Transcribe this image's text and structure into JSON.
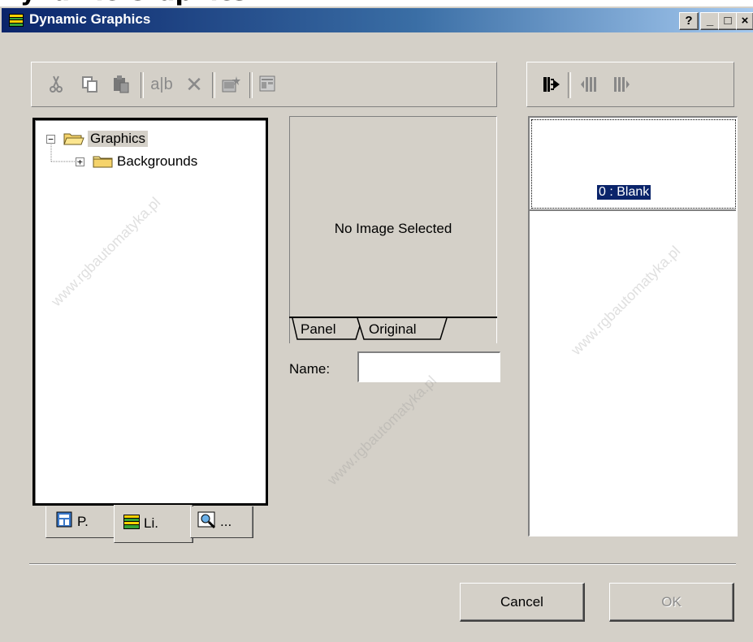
{
  "page_header": "Dynamic Graphics",
  "window": {
    "title": "Dynamic Graphics"
  },
  "caption_buttons": {
    "help": "?",
    "minimize": "_",
    "maximize": "□",
    "close": "×"
  },
  "toolbar_left": {
    "items": [
      {
        "icon": "cut-icon",
        "glyph": "✂"
      },
      {
        "icon": "copy-icon",
        "glyph": "⎘"
      },
      {
        "icon": "paste-icon",
        "glyph": "▦"
      },
      {
        "icon": "rename-icon",
        "glyph": "ab"
      },
      {
        "icon": "delete-icon",
        "glyph": "✕"
      },
      {
        "icon": "new-item-icon",
        "glyph": "✱"
      },
      {
        "icon": "properties-icon",
        "glyph": "☷"
      }
    ]
  },
  "toolbar_right": {
    "items": [
      {
        "icon": "insert-frame-icon"
      },
      {
        "icon": "frame-left-icon"
      },
      {
        "icon": "frame-right-icon"
      }
    ]
  },
  "tree": {
    "root": {
      "label": "Graphics",
      "expander": "−"
    },
    "child": {
      "label": "Backgrounds",
      "expander": "+"
    }
  },
  "left_tabs": [
    {
      "label": "P."
    },
    {
      "label": "Li."
    },
    {
      "label": "..."
    }
  ],
  "preview": {
    "message": "No Image Selected",
    "tabs": [
      {
        "label": "Panel"
      },
      {
        "label": "Original"
      }
    ]
  },
  "name_field": {
    "label": "Name:",
    "value": ""
  },
  "frames": [
    {
      "label": "0 : Blank"
    }
  ],
  "buttons": {
    "cancel": "Cancel",
    "ok": "OK"
  },
  "watermark": "www.rgbautomatyka.pl"
}
